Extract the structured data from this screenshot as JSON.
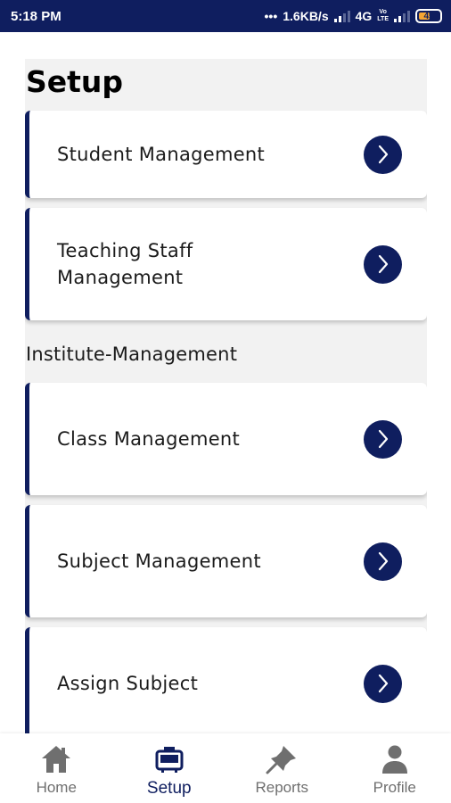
{
  "status_bar": {
    "time": "5:18 PM",
    "dots": "•••",
    "speed": "1.6KB/s",
    "network": "4G",
    "volte_top": "Vo",
    "volte_bottom": "LTE",
    "battery": "45"
  },
  "page": {
    "title": "Setup"
  },
  "cards_top": [
    {
      "label": "Student Management"
    },
    {
      "label": "Teaching Staff Management"
    }
  ],
  "section": {
    "title": "Institute-Management"
  },
  "cards_institute": [
    {
      "label": "Class Management"
    },
    {
      "label": "Subject Management"
    },
    {
      "label": "Assign Subject"
    }
  ],
  "bottom_nav": {
    "items": [
      {
        "label": "Home",
        "icon": "home-icon"
      },
      {
        "label": "Setup",
        "icon": "setup-icon",
        "active": true
      },
      {
        "label": "Reports",
        "icon": "reports-icon"
      },
      {
        "label": "Profile",
        "icon": "profile-icon"
      }
    ]
  },
  "colors": {
    "primary": "#0f1e5f",
    "background": "#f2f2f2",
    "inactive": "#6f6f6f"
  }
}
